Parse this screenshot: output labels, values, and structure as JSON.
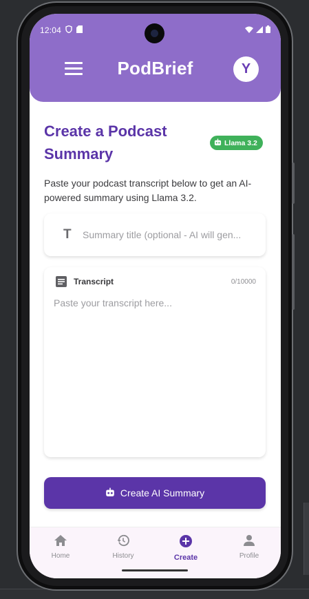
{
  "status_bar": {
    "time": "12:04"
  },
  "header": {
    "app_title": "PodBrief",
    "avatar_initial": "Y"
  },
  "main": {
    "title": "Create a Podcast Summary",
    "model_badge": "Llama 3.2",
    "description": "Paste your podcast transcript below to get an AI-powered summary using Llama 3.2.",
    "title_input": {
      "placeholder": "Summary title (optional - AI will gen...",
      "value": ""
    },
    "transcript": {
      "label": "Transcript",
      "counter": "0/10000",
      "placeholder": "Paste your transcript here...",
      "value": ""
    },
    "create_button": "Create AI Summary"
  },
  "bottom_nav": {
    "items": [
      {
        "label": "Home",
        "icon": "home-icon",
        "active": false
      },
      {
        "label": "History",
        "icon": "history-icon",
        "active": false
      },
      {
        "label": "Create",
        "icon": "add-circle-icon",
        "active": true
      },
      {
        "label": "Profile",
        "icon": "person-icon",
        "active": false
      }
    ]
  },
  "colors": {
    "primary": "#5b35a8",
    "header": "#8e6dc9",
    "badge": "#3fb15a",
    "nav_bg": "#fbf4fb"
  }
}
